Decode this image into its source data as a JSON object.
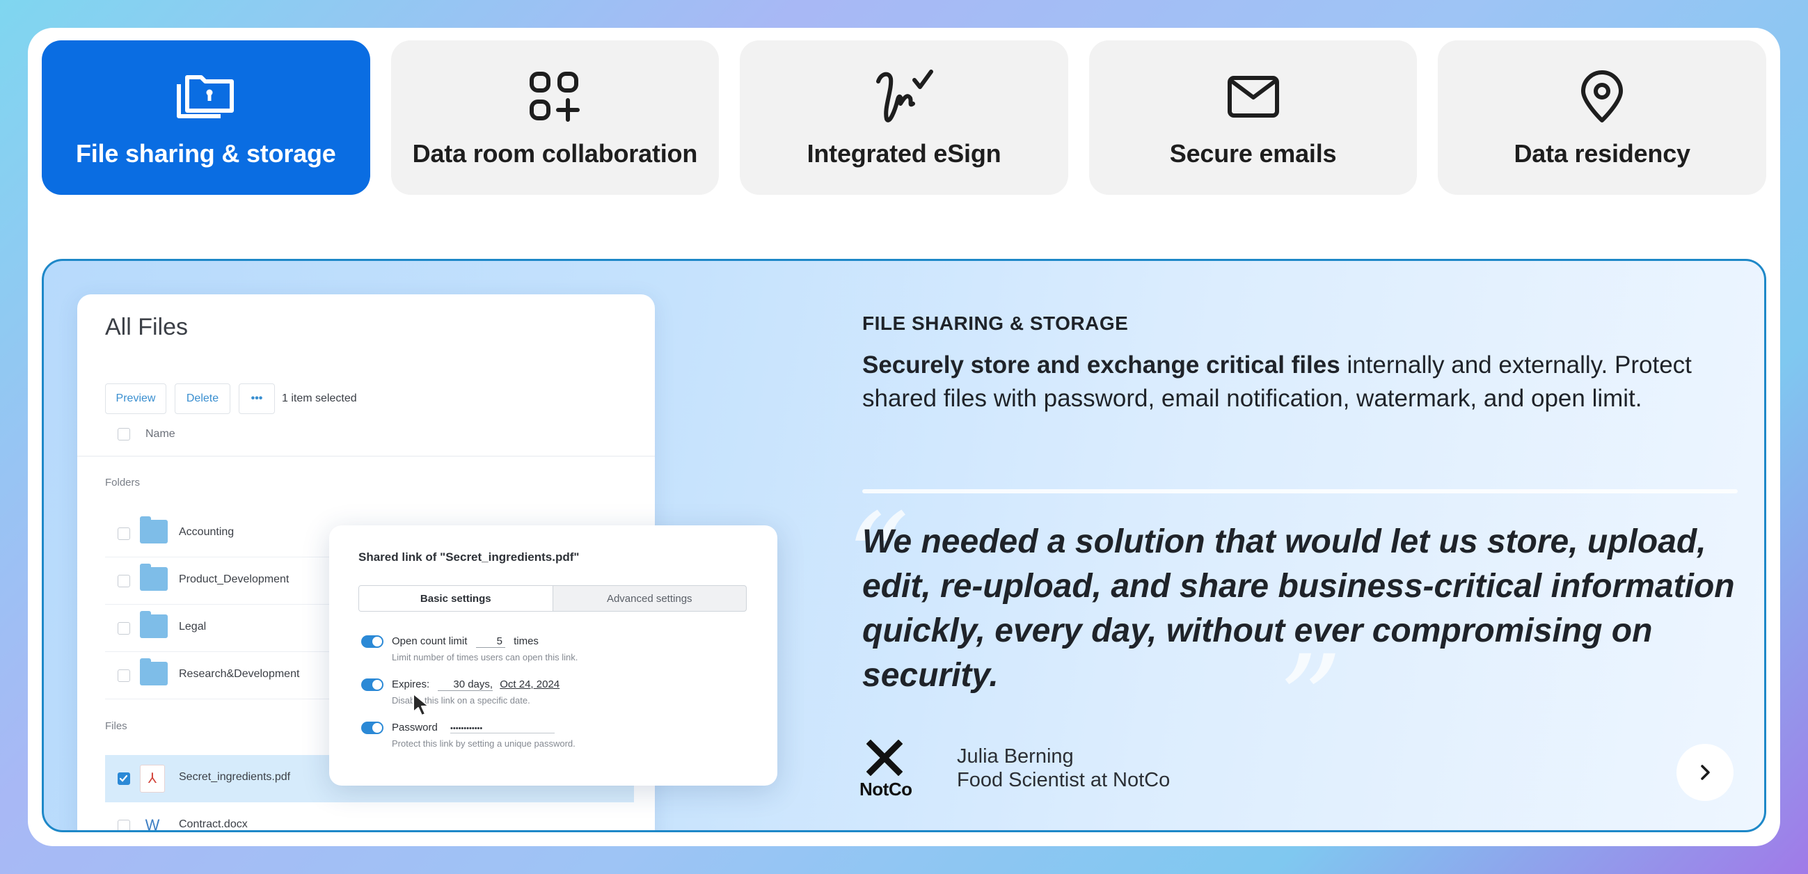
{
  "tabs": [
    {
      "label": "File sharing & storage",
      "icon": "folder-lock-icon",
      "active": true
    },
    {
      "label": "Data room collaboration",
      "icon": "grid-plus-icon",
      "active": false
    },
    {
      "label": "Integrated eSign",
      "icon": "signature-check-icon",
      "active": false
    },
    {
      "label": "Secure emails",
      "icon": "envelope-icon",
      "active": false
    },
    {
      "label": "Data residency",
      "icon": "map-pin-icon",
      "active": false
    }
  ],
  "colors": {
    "accent": "#0a6de2",
    "panel_border": "#1e88c8",
    "toggle": "#2b89d6"
  },
  "file_manager": {
    "title": "All Files",
    "preview_label": "Preview",
    "delete_label": "Delete",
    "more_label": "•••",
    "selected_text": "1 item selected",
    "name_header": "Name",
    "folders_label": "Folders",
    "folders": [
      "Accounting",
      "Product_Development",
      "Legal",
      "Research&Development"
    ],
    "files_label": "Files",
    "files": [
      {
        "name": "Secret_ingredients.pdf",
        "type": "pdf",
        "selected": true
      },
      {
        "name": "Contract.docx",
        "type": "docx",
        "selected": false
      }
    ],
    "pdf_glyph": "⅄",
    "doc_glyph": "W"
  },
  "modal": {
    "title": "Shared link of \"Secret_ingredients.pdf\"",
    "tab_basic": "Basic settings",
    "tab_advanced": "Advanced settings",
    "open_count": {
      "label": "Open count limit",
      "value": "5",
      "unit": "times",
      "sub": "Limit number of times users can open this link."
    },
    "expires": {
      "label": "Expires:",
      "value": "30 days,",
      "date": "Oct 24, 2024",
      "sub": "Disable this link on a specific date."
    },
    "password": {
      "label": "Password",
      "value": "••••••••••••",
      "sub": "Protect this link by setting a unique password."
    }
  },
  "content": {
    "eyebrow": "FILE SHARING & STORAGE",
    "desc_bold": "Securely store and exchange critical files",
    "desc_rest": " internally and externally. Protect shared files with password, email notification, watermark, and open limit.",
    "quote_open": "“",
    "quote_close": "”",
    "quote": "We needed a solution that would let us store, upload, edit, re-upload, and share business-critical information quickly, every day, without ever compromising on security.",
    "logo_text": "NotCo",
    "person_name": "Julia Berning",
    "person_role": "Food Scientist at NotCo"
  }
}
